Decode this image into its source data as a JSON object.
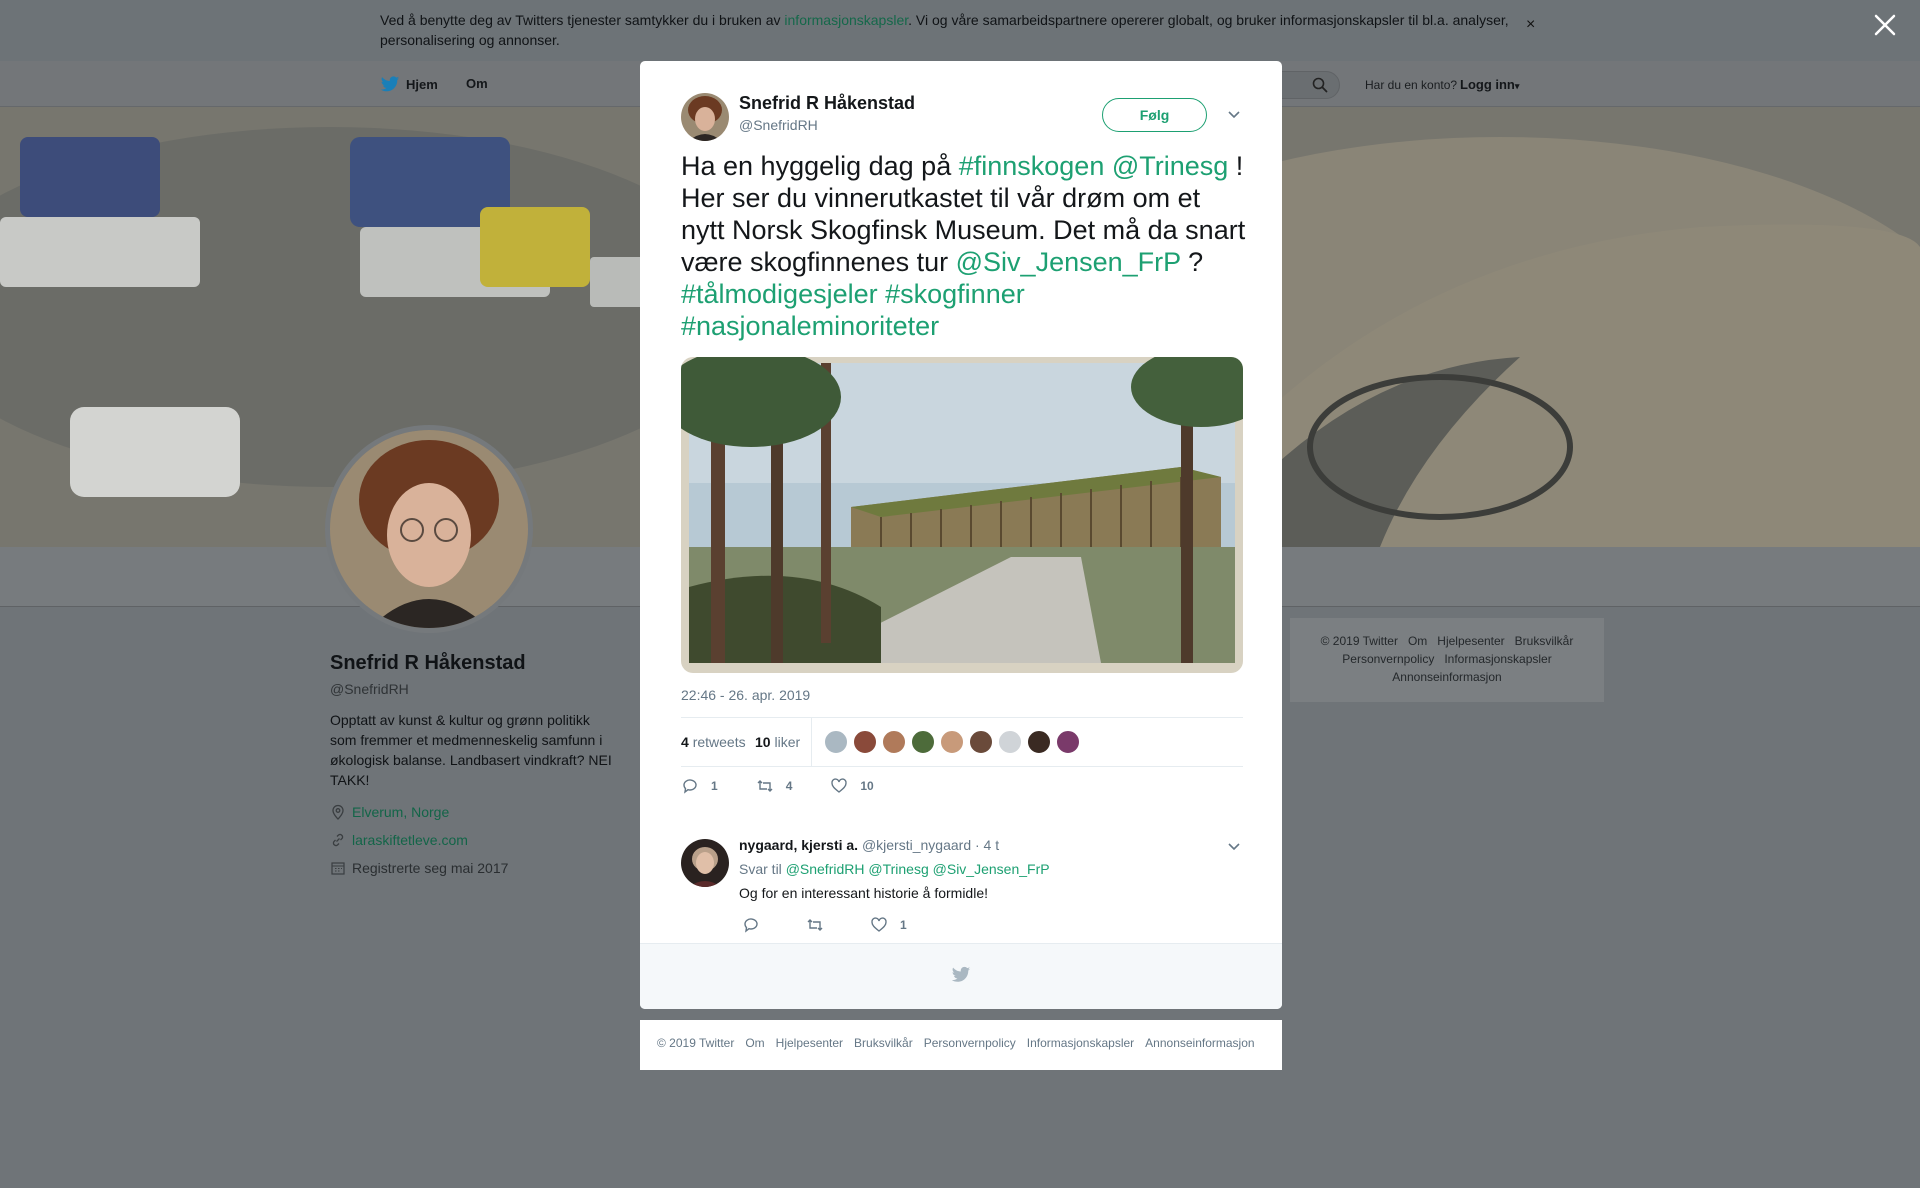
{
  "cookie_banner": {
    "text_before": "Ved å benytte deg av Twitters tjenester samtykker du i bruken av ",
    "link": "informasjonskapsler",
    "text_after": ". Vi og våre samarbeidspartnere opererer globalt, og bruker informasjonskapsler til bl.a. analyser, personalisering og annonser.",
    "close": "×"
  },
  "nav": {
    "home": "Hjem",
    "about": "Om",
    "have_account": "Har du en konto?",
    "login": "Logg inn"
  },
  "profile": {
    "name": "Snefrid R Håkenstad",
    "handle": "@SnefridRH",
    "bio": "Opptatt av kunst & kultur og grønn politikk som fremmer et medmenneskelig samfunn i økologisk balanse. Landbasert vindkraft? NEI TAKK!",
    "location": "Elverum, Norge",
    "website": "laraskiftetleve.com",
    "joined": "Registrerte seg mai 2017"
  },
  "side_footer": {
    "row1": [
      "© 2019 Twitter",
      "Om",
      "Hjelpesenter",
      "Bruksvilkår"
    ],
    "row2": [
      "Personvernpolicy",
      "Informasjonskapsler"
    ],
    "row3": [
      "Annonseinformasjon"
    ]
  },
  "tweet": {
    "author_name": "Snefrid R Håkenstad",
    "author_handle": "@SnefridRH",
    "follow_label": "Følg",
    "text": [
      {
        "t": "Ha en hyggelig dag på ",
        "tag": false
      },
      {
        "t": "#finnskogen",
        "tag": true
      },
      {
        "t": " ",
        "tag": false
      },
      {
        "t": "@Trinesg",
        "tag": true
      },
      {
        "t": " ! Her ser du vinnerutkastet til vår drøm om et nytt Norsk Skogfinsk Museum. Det må da snart være skogfinnenes tur ",
        "tag": false
      },
      {
        "t": "@Siv_Jensen_FrP",
        "tag": true
      },
      {
        "t": " ? ",
        "tag": false
      },
      {
        "t": "#tålmodigesjeler",
        "tag": true
      },
      {
        "t": " ",
        "tag": false
      },
      {
        "t": "#skogfinner",
        "tag": true
      },
      {
        "t": " ",
        "tag": false
      },
      {
        "t": "#nasjonaleminoriteter",
        "tag": true
      }
    ],
    "timestamp": "22:46 - 26. apr. 2019",
    "retweets_count": "4",
    "retweets_label": "retweets",
    "likes_count": "10",
    "likes_label": "liker",
    "reply_count": "1",
    "retweet_action_count": "4",
    "like_action_count": "10",
    "liker_colors": [
      "#aab8c2",
      "#8a4a3a",
      "#b07a5a",
      "#4d6b3a",
      "#c89a7a",
      "#6a4a3a",
      "#d0d4d8",
      "#3a2a22",
      "#7a3a6a"
    ]
  },
  "reply": {
    "name": "nygaard, kjersti a.",
    "handle": "@kjersti_nygaard",
    "time": "· 4 t",
    "reply_to_label": "Svar til",
    "reply_to": [
      "@SnefridRH",
      "@Trinesg",
      "@Siv_Jensen_FrP"
    ],
    "text": "Og for en interessant historie å formidle!",
    "like_count": "1"
  },
  "modal_footer": [
    "© 2019 Twitter",
    "Om",
    "Hjelpesenter",
    "Bruksvilkår",
    "Personvernpolicy",
    "Informasjonskapsler",
    "Annonseinformasjon"
  ],
  "colors": {
    "accent": "#1da072",
    "overlay": "#6f7478"
  }
}
